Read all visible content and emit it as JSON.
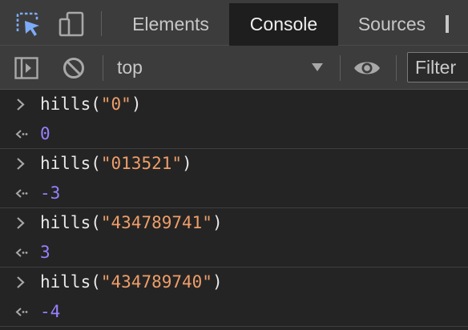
{
  "tabs": {
    "elements": "Elements",
    "console": "Console",
    "sources": "Sources"
  },
  "toolbar": {
    "context": "top",
    "filter_placeholder": "Filter"
  },
  "icons": {
    "inspect": "inspect-element-icon",
    "device": "device-toolbar-icon",
    "sidebar": "console-sidebar-icon",
    "clear": "clear-console-icon",
    "dropdown": "chevron-down-icon",
    "eye": "live-expression-icon",
    "input_prompt": "chevron-right-icon",
    "result_prompt": "return-arrow-icon"
  },
  "colors": {
    "accent": "#7cacf8",
    "string": "#ee9e6a",
    "number": "#9980ff"
  },
  "console": {
    "entries": [
      {
        "fn": "hills",
        "open": "(",
        "arg": "\"0\"",
        "close": ")",
        "result": "0"
      },
      {
        "fn": "hills",
        "open": "(",
        "arg": "\"013521\"",
        "close": ")",
        "result": "-3"
      },
      {
        "fn": "hills",
        "open": "(",
        "arg": "\"434789741\"",
        "close": ")",
        "result": "3"
      },
      {
        "fn": "hills",
        "open": "(",
        "arg": "\"434789740\"",
        "close": ")",
        "result": "-4"
      }
    ]
  }
}
